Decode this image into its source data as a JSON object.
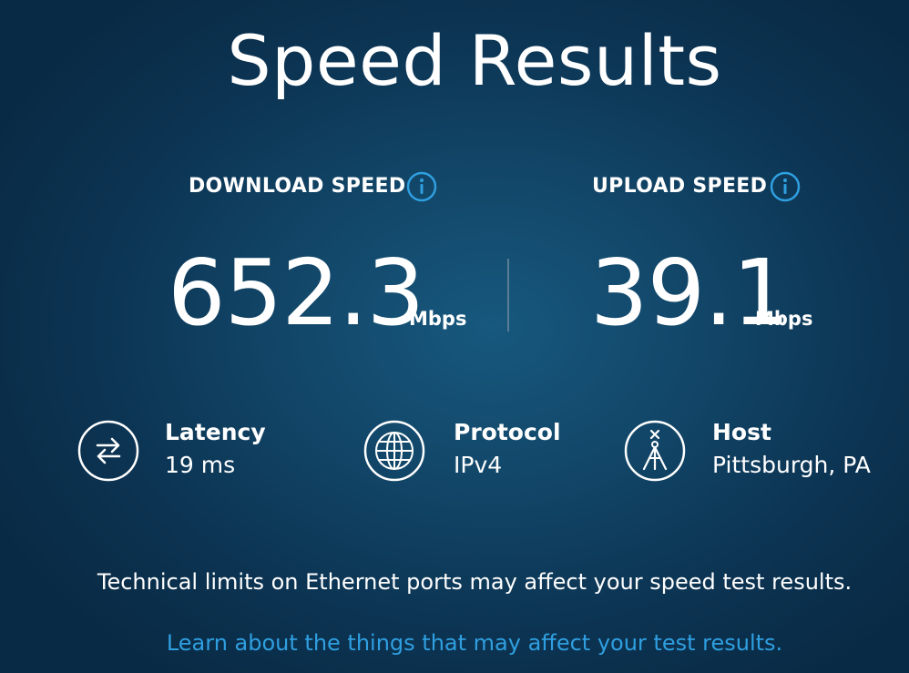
{
  "page": {
    "title": "Speed Results"
  },
  "download": {
    "label": "DOWNLOAD SPEED",
    "value": "652.3",
    "unit": "Mbps"
  },
  "upload": {
    "label": "UPLOAD SPEED",
    "value": "39.1",
    "unit": "Mbps"
  },
  "stats": {
    "latency": {
      "title": "Latency",
      "value": "19 ms",
      "icon": "transfer-arrows-icon"
    },
    "protocol": {
      "title": "Protocol",
      "value": "IPv4",
      "icon": "globe-icon"
    },
    "host": {
      "title": "Host",
      "value": "Pittsburgh, PA",
      "icon": "tower-icon"
    }
  },
  "footer": {
    "note": "Technical limits on Ethernet ports may affect your speed test results.",
    "link": "Learn about the things that may affect your test results."
  },
  "colors": {
    "background": "#124769",
    "accent": "#2f9fe0",
    "text": "#ffffff"
  }
}
